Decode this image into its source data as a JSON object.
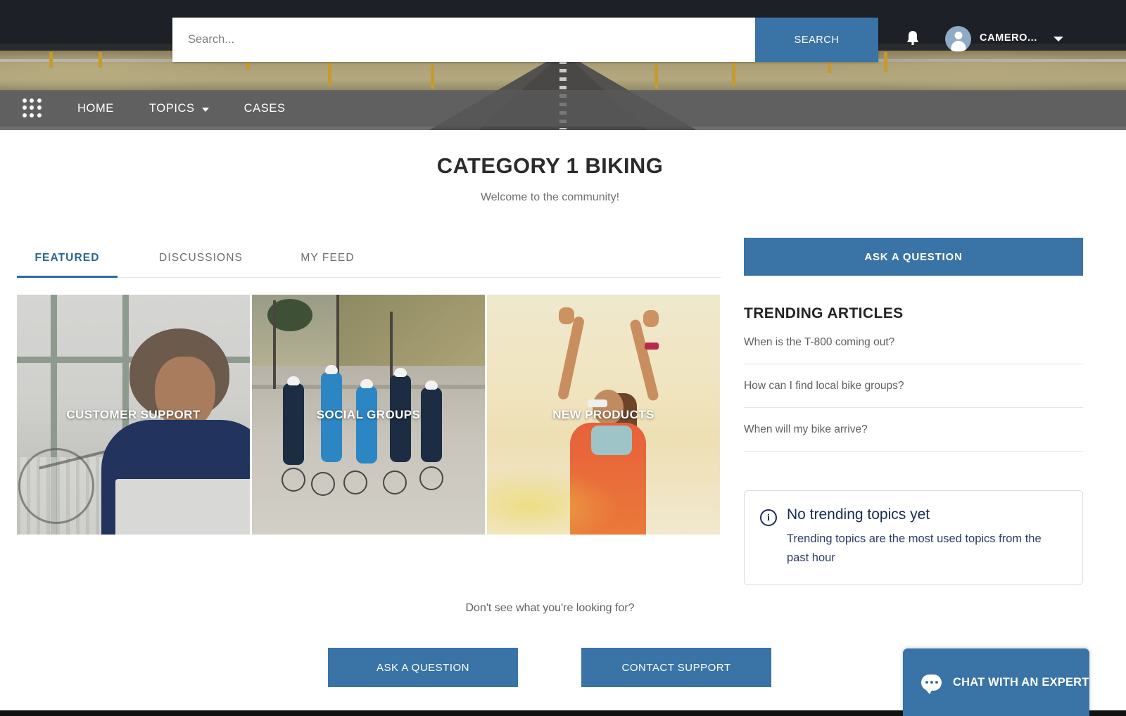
{
  "header": {
    "search": {
      "placeholder": "Search...",
      "value": "",
      "button_label": "SEARCH"
    },
    "notifications_icon": "bell-icon",
    "user": {
      "name": "CAMERO...",
      "avatar_icon": "user-avatar-icon"
    }
  },
  "nav": {
    "app_launcher_icon": "app-launcher-waffle-icon",
    "items": [
      {
        "label": "HOME",
        "has_caret": false
      },
      {
        "label": "TOPICS",
        "has_caret": true
      },
      {
        "label": "CASES",
        "has_caret": false
      }
    ]
  },
  "page": {
    "title": "CATEGORY 1 BIKING",
    "subtitle": "Welcome to the community!"
  },
  "tabs": [
    {
      "label": "FEATURED",
      "active": true
    },
    {
      "label": "DISCUSSIONS",
      "active": false
    },
    {
      "label": "MY FEED",
      "active": false
    }
  ],
  "tiles": [
    {
      "label": "CUSTOMER SUPPORT"
    },
    {
      "label": "SOCIAL GROUPS"
    },
    {
      "label": "NEW PRODUCTS"
    }
  ],
  "sidebar": {
    "ask_button": "ASK A QUESTION",
    "trending_heading": "TRENDING ARTICLES",
    "articles": [
      "When is the T-800 coming out?",
      "How can I find local bike groups?",
      "When will my bike arrive?"
    ],
    "info": {
      "icon": "info-circle-icon",
      "title": "No trending topics yet",
      "description": "Trending topics are the most used topics from the past hour"
    }
  },
  "cta": {
    "prompt": "Don't see what you're looking for?",
    "ask_label": "ASK A QUESTION",
    "contact_label": "CONTACT SUPPORT"
  },
  "chat": {
    "label": "CHAT WITH AN EXPERT",
    "icon": "chat-bubble-icon"
  },
  "colors": {
    "accent_blue": "#3a73a6",
    "tab_active": "#2d6ba0",
    "nav_bar": "#5a5a5c",
    "info_text": "#192a56"
  }
}
